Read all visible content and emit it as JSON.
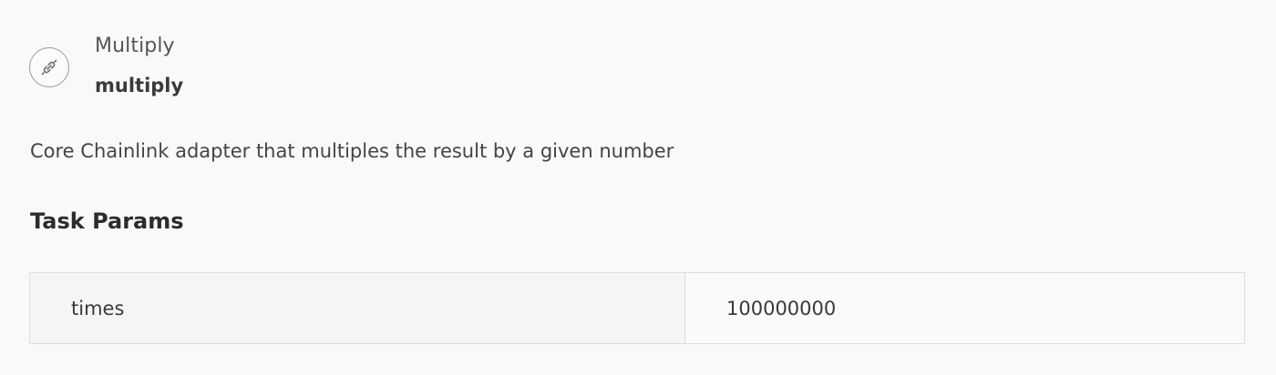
{
  "adapter": {
    "icon": "link-icon",
    "name": "Multiply",
    "type": "multiply"
  },
  "description": "Core Chainlink adapter that multiples the result by a given number",
  "task_params": {
    "title": "Task Params",
    "rows": [
      {
        "key": "times",
        "value": "100000000"
      }
    ]
  }
}
